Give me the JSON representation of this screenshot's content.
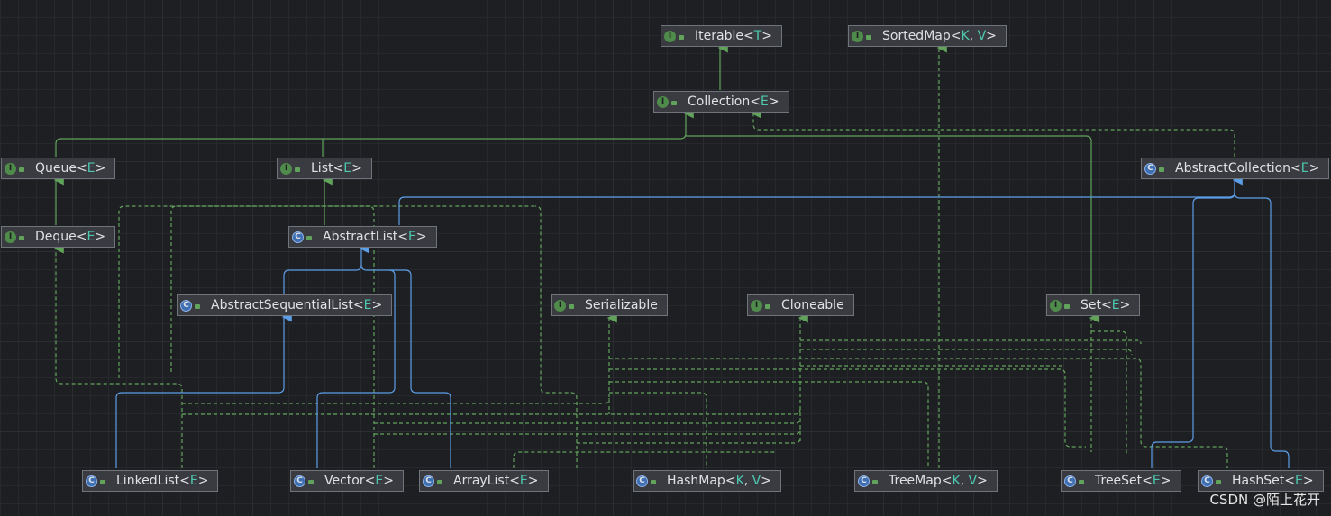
{
  "diagram": {
    "nodes": [
      {
        "id": "iterable",
        "name": "Iterable",
        "params": [
          "T"
        ],
        "kind": "interface"
      },
      {
        "id": "sortedmap",
        "name": "SortedMap",
        "params": [
          "K",
          "V"
        ],
        "kind": "interface"
      },
      {
        "id": "collection",
        "name": "Collection",
        "params": [
          "E"
        ],
        "kind": "interface"
      },
      {
        "id": "queue",
        "name": "Queue",
        "params": [
          "E"
        ],
        "kind": "interface"
      },
      {
        "id": "list",
        "name": "List",
        "params": [
          "E"
        ],
        "kind": "interface"
      },
      {
        "id": "abstractcollection",
        "name": "AbstractCollection",
        "params": [
          "E"
        ],
        "kind": "class"
      },
      {
        "id": "deque",
        "name": "Deque",
        "params": [
          "E"
        ],
        "kind": "interface"
      },
      {
        "id": "abstractlist",
        "name": "AbstractList",
        "params": [
          "E"
        ],
        "kind": "class"
      },
      {
        "id": "abstractsequentiallist",
        "name": "AbstractSequentialList",
        "params": [
          "E"
        ],
        "kind": "class"
      },
      {
        "id": "serializable",
        "name": "Serializable",
        "params": [],
        "kind": "interface"
      },
      {
        "id": "cloneable",
        "name": "Cloneable",
        "params": [],
        "kind": "interface"
      },
      {
        "id": "set",
        "name": "Set",
        "params": [
          "E"
        ],
        "kind": "interface"
      },
      {
        "id": "linkedlist",
        "name": "LinkedList",
        "params": [
          "E"
        ],
        "kind": "class"
      },
      {
        "id": "vector",
        "name": "Vector",
        "params": [
          "E"
        ],
        "kind": "class"
      },
      {
        "id": "arraylist",
        "name": "ArrayList",
        "params": [
          "E"
        ],
        "kind": "class"
      },
      {
        "id": "hashmap",
        "name": "HashMap",
        "params": [
          "K",
          "V"
        ],
        "kind": "class"
      },
      {
        "id": "treemap",
        "name": "TreeMap",
        "params": [
          "K",
          "V"
        ],
        "kind": "class"
      },
      {
        "id": "treeset",
        "name": "TreeSet",
        "params": [
          "E"
        ],
        "kind": "class"
      },
      {
        "id": "hashset",
        "name": "HashSet",
        "params": [
          "E"
        ],
        "kind": "class"
      }
    ],
    "edges": [
      {
        "from": "collection",
        "to": "iterable",
        "type": "extends"
      },
      {
        "from": "queue",
        "to": "collection",
        "type": "extends"
      },
      {
        "from": "list",
        "to": "collection",
        "type": "extends"
      },
      {
        "from": "set",
        "to": "collection",
        "type": "extends"
      },
      {
        "from": "deque",
        "to": "queue",
        "type": "extends"
      },
      {
        "from": "abstractcollection",
        "to": "collection",
        "type": "implements"
      },
      {
        "from": "abstractlist",
        "to": "list",
        "type": "implements"
      },
      {
        "from": "abstractlist",
        "to": "abstractcollection",
        "type": "inherits"
      },
      {
        "from": "abstractsequentiallist",
        "to": "abstractlist",
        "type": "inherits"
      },
      {
        "from": "linkedlist",
        "to": "abstractsequentiallist",
        "type": "inherits"
      },
      {
        "from": "linkedlist",
        "to": "deque",
        "type": "implements"
      },
      {
        "from": "linkedlist",
        "to": "list",
        "type": "implements"
      },
      {
        "from": "linkedlist",
        "to": "serializable",
        "type": "implements"
      },
      {
        "from": "linkedlist",
        "to": "cloneable",
        "type": "implements"
      },
      {
        "from": "vector",
        "to": "abstractlist",
        "type": "inherits"
      },
      {
        "from": "vector",
        "to": "list",
        "type": "implements"
      },
      {
        "from": "vector",
        "to": "serializable",
        "type": "implements"
      },
      {
        "from": "vector",
        "to": "cloneable",
        "type": "implements"
      },
      {
        "from": "arraylist",
        "to": "abstractlist",
        "type": "inherits"
      },
      {
        "from": "arraylist",
        "to": "list",
        "type": "implements"
      },
      {
        "from": "arraylist",
        "to": "serializable",
        "type": "implements"
      },
      {
        "from": "arraylist",
        "to": "cloneable",
        "type": "implements"
      },
      {
        "from": "hashmap",
        "to": "serializable",
        "type": "implements"
      },
      {
        "from": "hashmap",
        "to": "cloneable",
        "type": "implements"
      },
      {
        "from": "treemap",
        "to": "sortedmap",
        "type": "implements"
      },
      {
        "from": "treemap",
        "to": "serializable",
        "type": "implements"
      },
      {
        "from": "treemap",
        "to": "cloneable",
        "type": "implements"
      },
      {
        "from": "treeset",
        "to": "abstractcollection",
        "type": "inherits"
      },
      {
        "from": "treeset",
        "to": "set",
        "type": "implements"
      },
      {
        "from": "treeset",
        "to": "serializable",
        "type": "implements"
      },
      {
        "from": "treeset",
        "to": "cloneable",
        "type": "implements"
      },
      {
        "from": "hashset",
        "to": "abstractcollection",
        "type": "inherits"
      },
      {
        "from": "hashset",
        "to": "set",
        "type": "implements"
      },
      {
        "from": "hashset",
        "to": "serializable",
        "type": "implements"
      },
      {
        "from": "hashset",
        "to": "cloneable",
        "type": "implements"
      }
    ],
    "colors": {
      "background": "#1e1f22",
      "node_fill": "#393b40",
      "node_border": "#6f737a",
      "text": "#dfe1e5",
      "type_param": "#4ec9b0",
      "extends_edge": "#62a35c",
      "implements_edge": "#62a35c",
      "inherits_edge": "#5c9ee8"
    }
  },
  "watermark": "CSDN @陌上花开\u0010"
}
